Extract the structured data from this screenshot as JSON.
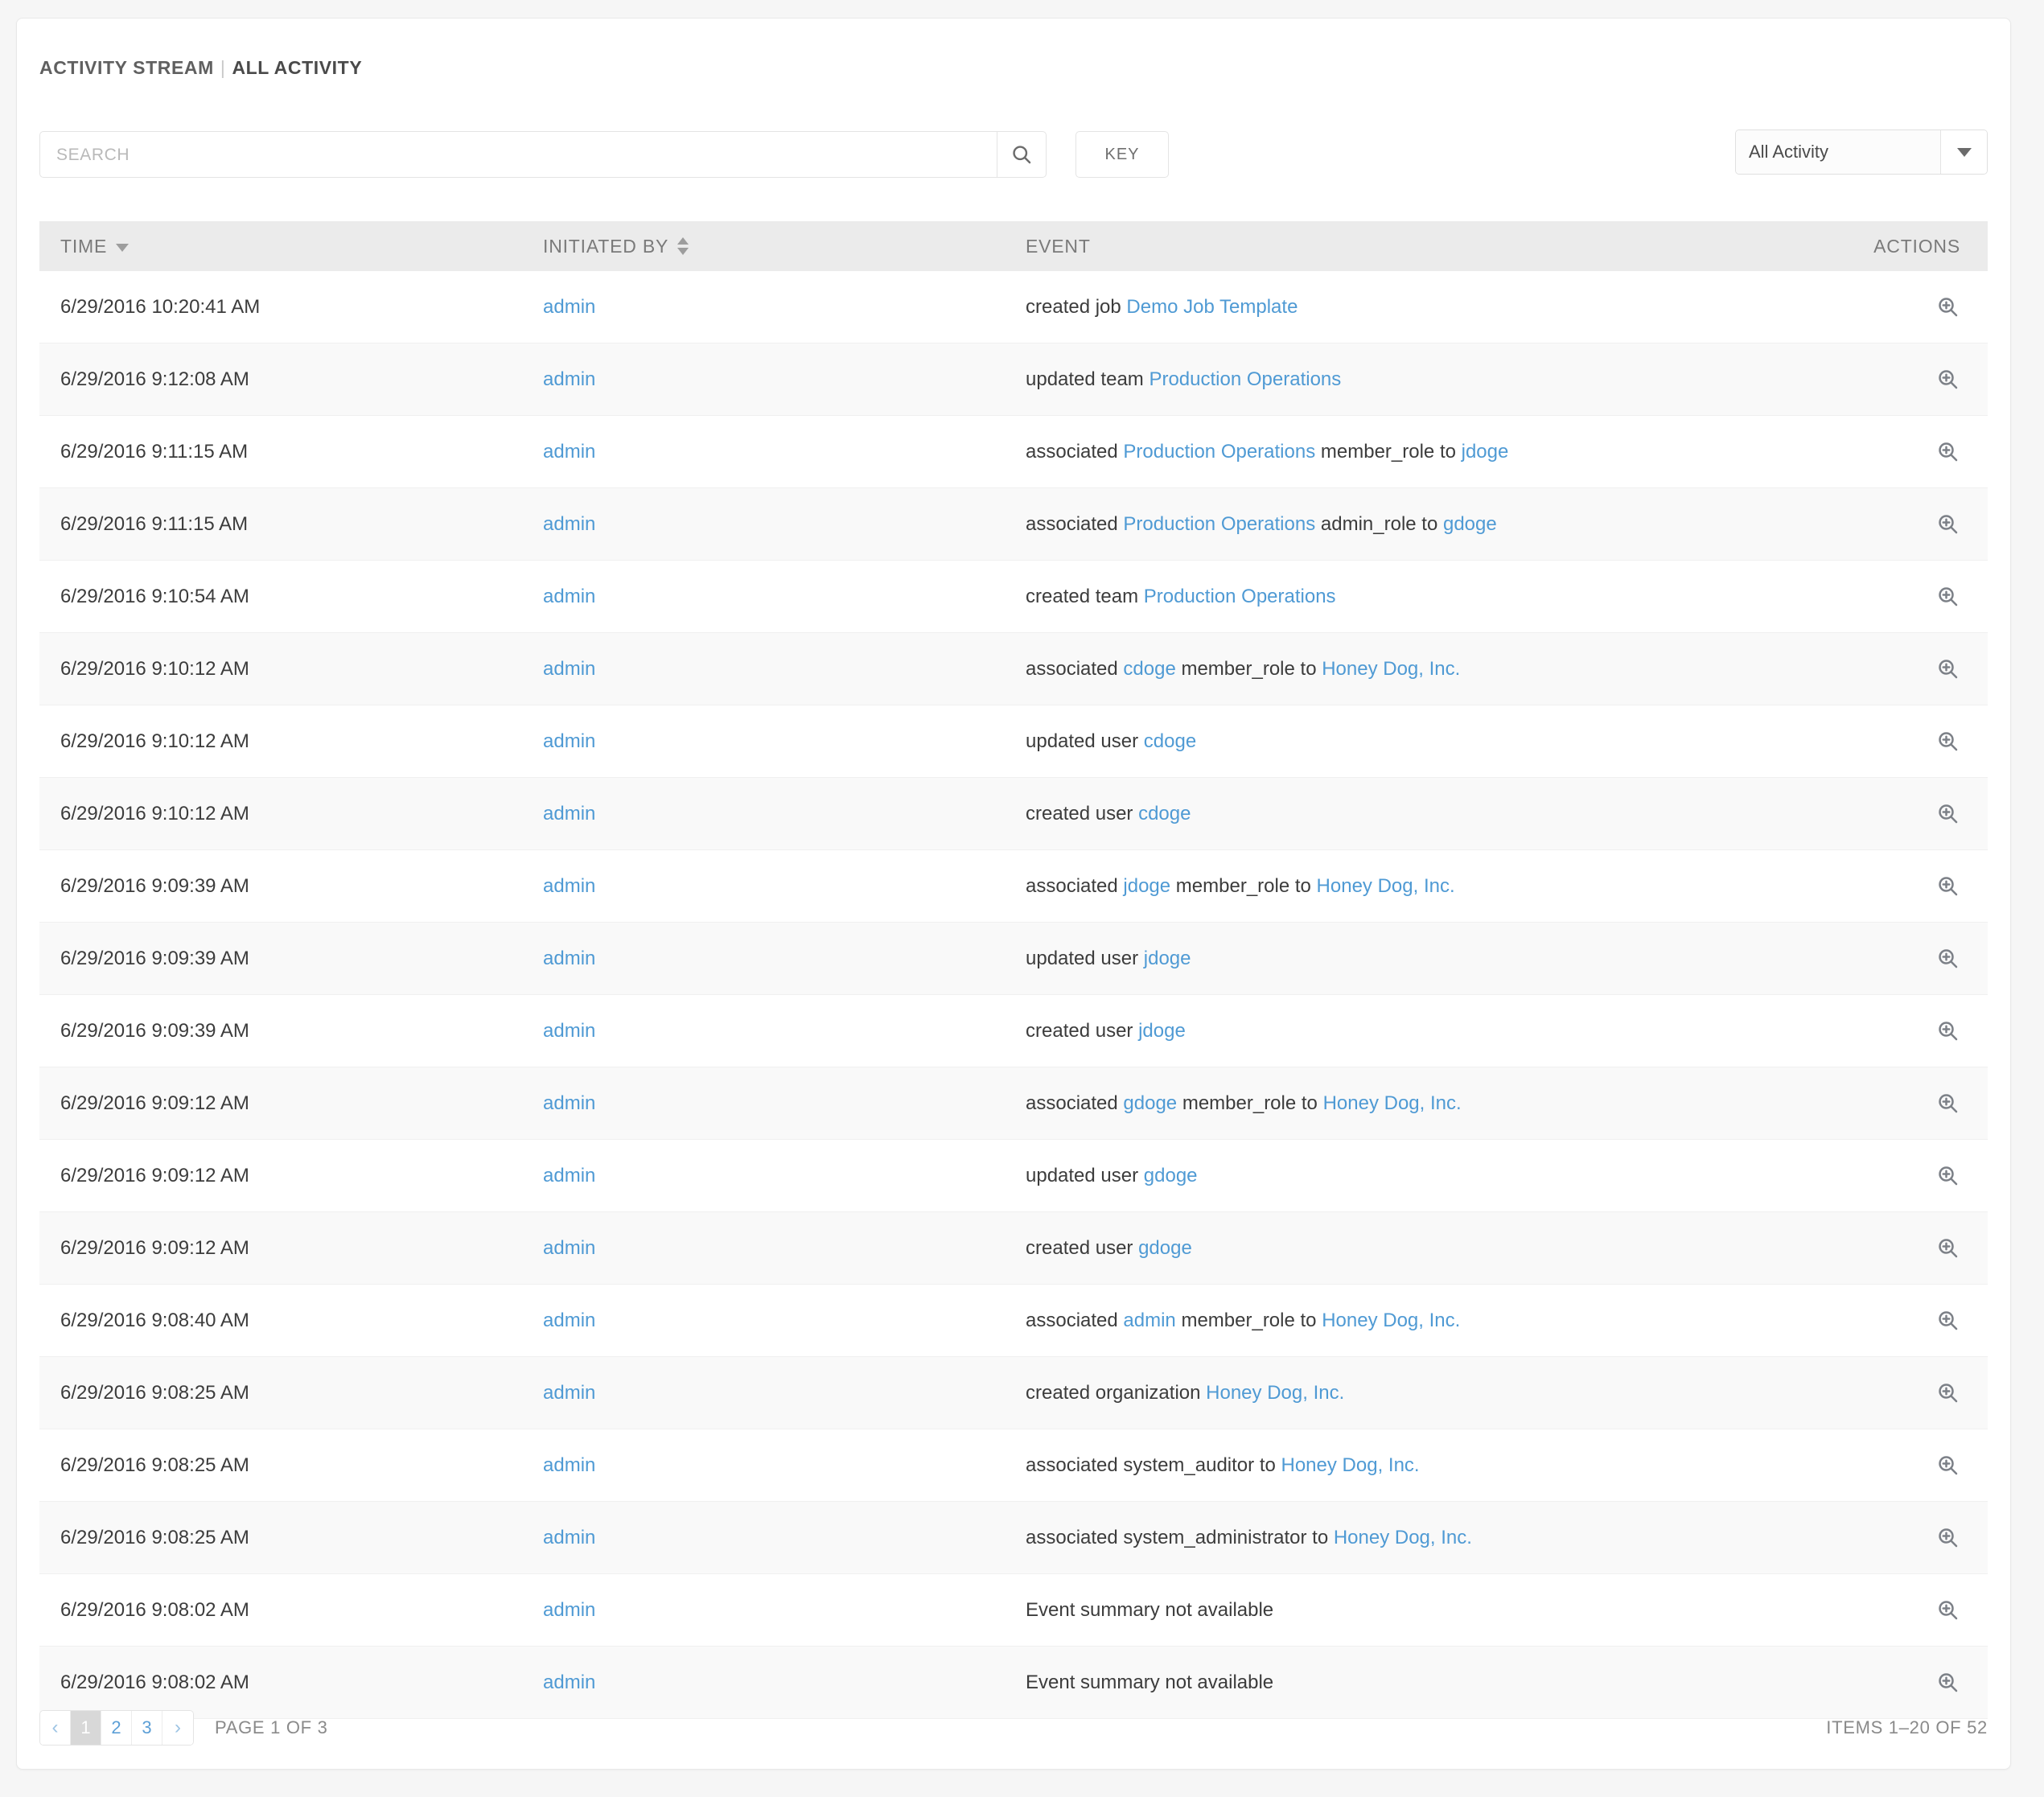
{
  "breadcrumb": {
    "parent": "ACTIVITY STREAM",
    "separator": "|",
    "current": "ALL ACTIVITY"
  },
  "toolbar": {
    "search_placeholder": "SEARCH",
    "search_value": "",
    "search_icon": "search-icon",
    "key_label": "KEY",
    "filter_selected": "All Activity",
    "filter_caret_icon": "chevron-down-icon"
  },
  "table": {
    "columns": [
      {
        "label": "TIME",
        "sort": "desc"
      },
      {
        "label": "INITIATED BY",
        "sort": "both"
      },
      {
        "label": "EVENT",
        "sort": "none"
      },
      {
        "label": "ACTIONS",
        "sort": "none"
      }
    ],
    "action_icon": "zoom-in-icon",
    "rows": [
      {
        "time": "6/29/2016 10:20:41 AM",
        "user": "admin",
        "event": [
          {
            "t": "created job ",
            "link": false
          },
          {
            "t": "Demo Job Template",
            "link": true
          }
        ]
      },
      {
        "time": "6/29/2016 9:12:08 AM",
        "user": "admin",
        "event": [
          {
            "t": "updated team ",
            "link": false
          },
          {
            "t": "Production Operations",
            "link": true
          }
        ]
      },
      {
        "time": "6/29/2016 9:11:15 AM",
        "user": "admin",
        "event": [
          {
            "t": "associated ",
            "link": false
          },
          {
            "t": "Production Operations",
            "link": true
          },
          {
            "t": " member_role to ",
            "link": false
          },
          {
            "t": "jdoge",
            "link": true
          }
        ]
      },
      {
        "time": "6/29/2016 9:11:15 AM",
        "user": "admin",
        "event": [
          {
            "t": "associated ",
            "link": false
          },
          {
            "t": "Production Operations",
            "link": true
          },
          {
            "t": " admin_role to ",
            "link": false
          },
          {
            "t": "gdoge",
            "link": true
          }
        ]
      },
      {
        "time": "6/29/2016 9:10:54 AM",
        "user": "admin",
        "event": [
          {
            "t": "created team ",
            "link": false
          },
          {
            "t": "Production Operations",
            "link": true
          }
        ]
      },
      {
        "time": "6/29/2016 9:10:12 AM",
        "user": "admin",
        "event": [
          {
            "t": "associated ",
            "link": false
          },
          {
            "t": "cdoge",
            "link": true
          },
          {
            "t": " member_role to ",
            "link": false
          },
          {
            "t": "Honey Dog, Inc.",
            "link": true
          }
        ]
      },
      {
        "time": "6/29/2016 9:10:12 AM",
        "user": "admin",
        "event": [
          {
            "t": "updated user ",
            "link": false
          },
          {
            "t": "cdoge",
            "link": true
          }
        ]
      },
      {
        "time": "6/29/2016 9:10:12 AM",
        "user": "admin",
        "event": [
          {
            "t": "created user ",
            "link": false
          },
          {
            "t": "cdoge",
            "link": true
          }
        ]
      },
      {
        "time": "6/29/2016 9:09:39 AM",
        "user": "admin",
        "event": [
          {
            "t": "associated ",
            "link": false
          },
          {
            "t": "jdoge",
            "link": true
          },
          {
            "t": " member_role to ",
            "link": false
          },
          {
            "t": "Honey Dog, Inc.",
            "link": true
          }
        ]
      },
      {
        "time": "6/29/2016 9:09:39 AM",
        "user": "admin",
        "event": [
          {
            "t": "updated user ",
            "link": false
          },
          {
            "t": "jdoge",
            "link": true
          }
        ]
      },
      {
        "time": "6/29/2016 9:09:39 AM",
        "user": "admin",
        "event": [
          {
            "t": "created user ",
            "link": false
          },
          {
            "t": "jdoge",
            "link": true
          }
        ]
      },
      {
        "time": "6/29/2016 9:09:12 AM",
        "user": "admin",
        "event": [
          {
            "t": "associated ",
            "link": false
          },
          {
            "t": "gdoge",
            "link": true
          },
          {
            "t": " member_role to ",
            "link": false
          },
          {
            "t": "Honey Dog, Inc.",
            "link": true
          }
        ]
      },
      {
        "time": "6/29/2016 9:09:12 AM",
        "user": "admin",
        "event": [
          {
            "t": "updated user ",
            "link": false
          },
          {
            "t": "gdoge",
            "link": true
          }
        ]
      },
      {
        "time": "6/29/2016 9:09:12 AM",
        "user": "admin",
        "event": [
          {
            "t": "created user ",
            "link": false
          },
          {
            "t": "gdoge",
            "link": true
          }
        ]
      },
      {
        "time": "6/29/2016 9:08:40 AM",
        "user": "admin",
        "event": [
          {
            "t": "associated ",
            "link": false
          },
          {
            "t": "admin",
            "link": true
          },
          {
            "t": " member_role to ",
            "link": false
          },
          {
            "t": "Honey Dog, Inc.",
            "link": true
          }
        ]
      },
      {
        "time": "6/29/2016 9:08:25 AM",
        "user": "admin",
        "event": [
          {
            "t": "created organization ",
            "link": false
          },
          {
            "t": "Honey Dog, Inc.",
            "link": true
          }
        ]
      },
      {
        "time": "6/29/2016 9:08:25 AM",
        "user": "admin",
        "event": [
          {
            "t": "associated system_auditor to ",
            "link": false
          },
          {
            "t": "Honey Dog, Inc.",
            "link": true
          }
        ]
      },
      {
        "time": "6/29/2016 9:08:25 AM",
        "user": "admin",
        "event": [
          {
            "t": "associated system_administrator to ",
            "link": false
          },
          {
            "t": "Honey Dog, Inc.",
            "link": true
          }
        ]
      },
      {
        "time": "6/29/2016 9:08:02 AM",
        "user": "admin",
        "event": [
          {
            "t": "Event summary not available",
            "link": false
          }
        ]
      },
      {
        "time": "6/29/2016 9:08:02 AM",
        "user": "admin",
        "event": [
          {
            "t": "Event summary not available",
            "link": false
          }
        ]
      }
    ]
  },
  "footer": {
    "prev_label": "‹",
    "next_label": "›",
    "pages": [
      "1",
      "2",
      "3"
    ],
    "active_page": "1",
    "page_label": "PAGE 1 OF 3",
    "items_label": "ITEMS 1–20 OF 52"
  },
  "colors": {
    "link": "#4f9ad4",
    "header_bg": "#ebebeb",
    "row_alt_bg": "#f9f9f9",
    "text": "#3c3c3c",
    "muted": "#8a8a8a"
  }
}
